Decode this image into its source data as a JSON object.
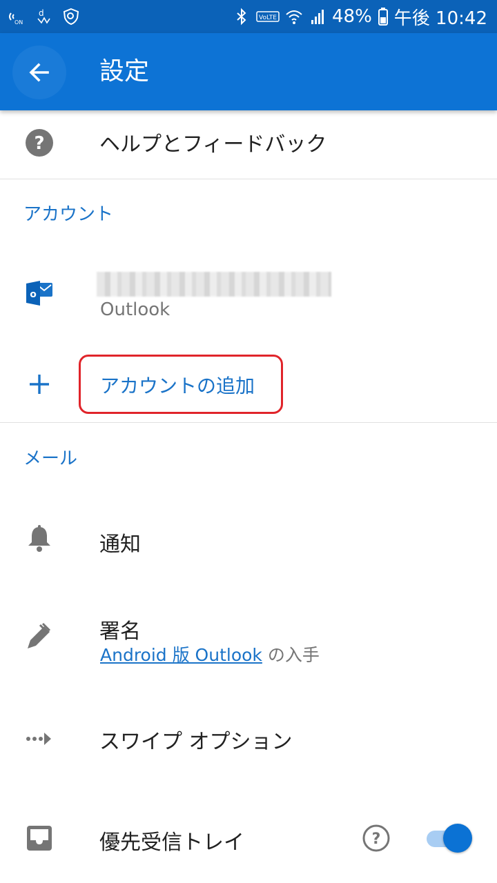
{
  "status_bar": {
    "battery": "48%",
    "time": "午後 10:42",
    "left_icons": [
      "nfc-icon",
      "docomo-icon",
      "shield-icon"
    ],
    "right_icons": [
      "bluetooth-icon",
      "volte-icon",
      "wifi-icon",
      "signal-icon",
      "battery-icon"
    ]
  },
  "app_bar": {
    "title": "設定",
    "back_icon": "arrow-back-icon"
  },
  "items": {
    "help": {
      "label": "ヘルプとフィードバック",
      "icon": "help-icon"
    },
    "account_section": "アカウント",
    "account": {
      "provider": "Outlook",
      "icon": "outlook-icon"
    },
    "add_account": {
      "label": "アカウントの追加",
      "icon": "plus-icon"
    },
    "mail_section": "メール",
    "notifications": {
      "label": "通知",
      "icon": "bell-icon"
    },
    "signature": {
      "label": "署名",
      "link_text": "Android 版 Outlook",
      "suffix": " の入手",
      "icon": "pen-icon"
    },
    "swipe": {
      "label": "スワイプ オプション",
      "icon": "swipe-icon"
    },
    "focused_inbox": {
      "label": "優先受信トレイ",
      "icon": "inbox-icon",
      "toggle_on": true
    }
  },
  "colors": {
    "status_bar": "#0b62b8",
    "app_bar": "#0d73d5",
    "accent": "#1a73c8",
    "highlight": "#e0242a"
  }
}
